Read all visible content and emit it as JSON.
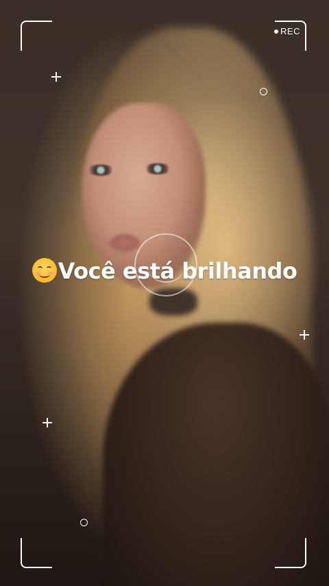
{
  "overlay": {
    "rec_label": "REC",
    "caption_text": "Você está brilhando",
    "caption_emoji": "smiling-face-with-smiling-eyes-emoji"
  },
  "icons": {
    "rec_indicator": "record-dot-icon",
    "focus_target": "smile-face-icon",
    "decorations": [
      "plus-icon",
      "circle-icon"
    ]
  },
  "colors": {
    "overlay": "#ffffff",
    "emoji_yellow": "#f8b830"
  }
}
